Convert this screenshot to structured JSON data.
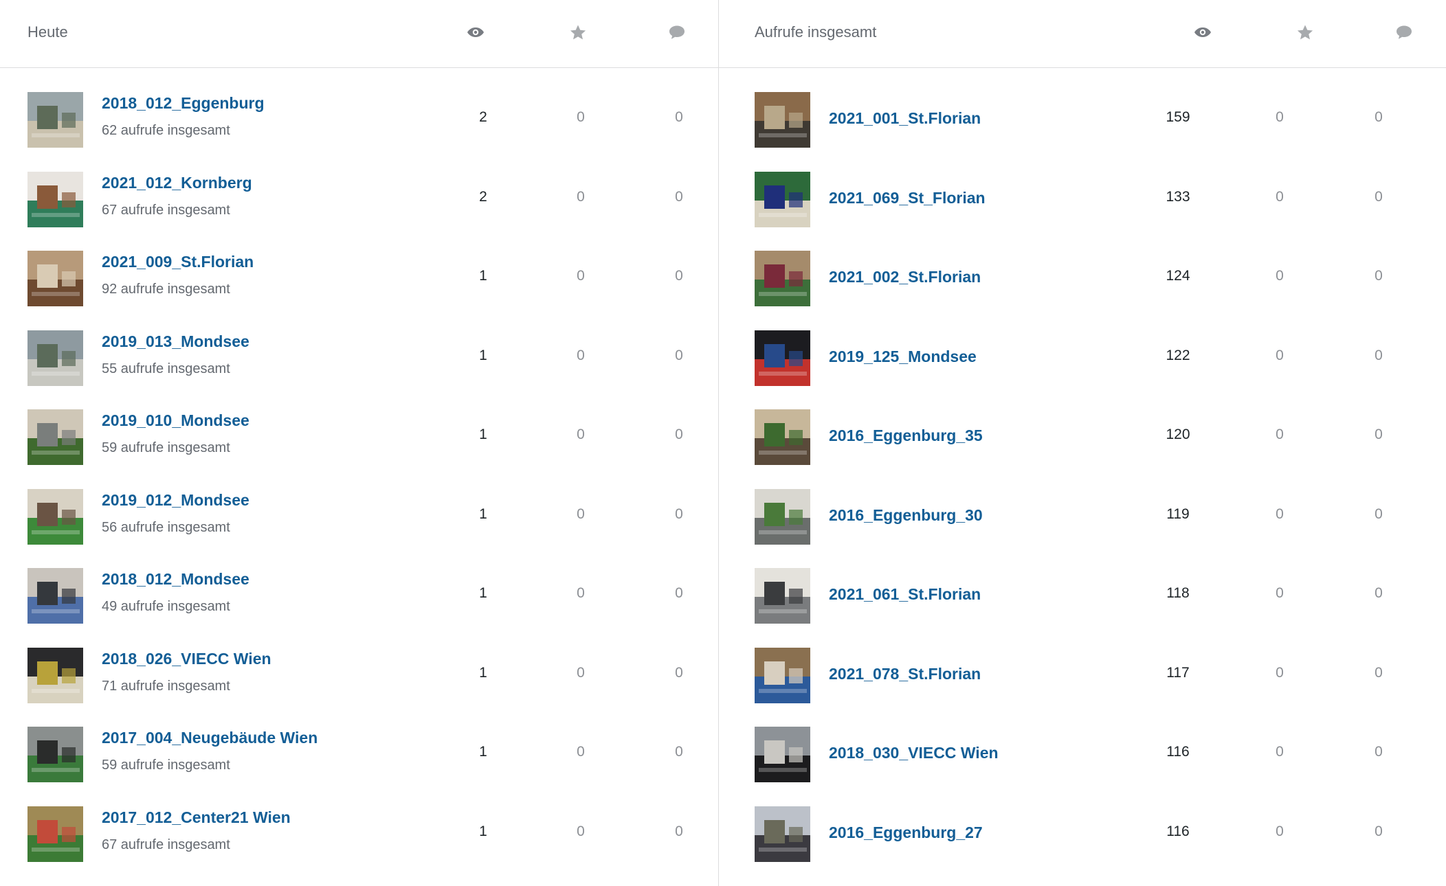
{
  "colors": {
    "link": "#135e96",
    "muted": "#646970",
    "icon": "#a7aaad",
    "divider": "#dcdcde"
  },
  "left": {
    "header": {
      "title": "Heute",
      "icons": [
        "eye-icon",
        "star-icon",
        "comment-icon"
      ]
    },
    "rows": [
      {
        "title": "2018_012_Eggenburg",
        "subtitle": "62 aufrufe insgesamt",
        "views": "2",
        "likes": "0",
        "comments": "0",
        "thumb": [
          "#9aa6a9",
          "#c9c1ad",
          "#5d6b58"
        ]
      },
      {
        "title": "2021_012_Kornberg",
        "subtitle": "67 aufrufe insgesamt",
        "views": "2",
        "likes": "0",
        "comments": "0",
        "thumb": [
          "#e8e4df",
          "#2f7d5a",
          "#8a5a3a"
        ]
      },
      {
        "title": "2021_009_St.Florian",
        "subtitle": "92 aufrufe insgesamt",
        "views": "1",
        "likes": "0",
        "comments": "0",
        "thumb": [
          "#b79a7a",
          "#6e4a30",
          "#d9cbb4"
        ]
      },
      {
        "title": "2019_013_Mondsee",
        "subtitle": "55 aufrufe insgesamt",
        "views": "1",
        "likes": "0",
        "comments": "0",
        "thumb": [
          "#8e9aa0",
          "#c7c7c0",
          "#5b6b5a"
        ]
      },
      {
        "title": "2019_010_Mondsee",
        "subtitle": "59 aufrufe insgesamt",
        "views": "1",
        "likes": "0",
        "comments": "0",
        "thumb": [
          "#cfc7b7",
          "#3f6a2e",
          "#7a7e7c"
        ]
      },
      {
        "title": "2019_012_Mondsee",
        "subtitle": "56 aufrufe insgesamt",
        "views": "1",
        "likes": "0",
        "comments": "0",
        "thumb": [
          "#d8d2c4",
          "#3d8a3a",
          "#6a5444"
        ]
      },
      {
        "title": "2018_012_Mondsee",
        "subtitle": "49 aufrufe insgesamt",
        "views": "1",
        "likes": "0",
        "comments": "0",
        "thumb": [
          "#c9c4bd",
          "#4f6fa8",
          "#34383d"
        ]
      },
      {
        "title": "2018_026_VIECC Wien",
        "subtitle": "71 aufrufe insgesamt",
        "views": "1",
        "likes": "0",
        "comments": "0",
        "thumb": [
          "#2a2a2c",
          "#d8d2bf",
          "#b8a23a"
        ]
      },
      {
        "title": "2017_004_Neugebäude Wien",
        "subtitle": "59 aufrufe insgesamt",
        "views": "1",
        "likes": "0",
        "comments": "0",
        "thumb": [
          "#8a8f8e",
          "#3a7a3b",
          "#2a2c2b"
        ]
      },
      {
        "title": "2017_012_Center21 Wien",
        "subtitle": "67 aufrufe insgesamt",
        "views": "1",
        "likes": "0",
        "comments": "0",
        "thumb": [
          "#9f8a55",
          "#3c7b35",
          "#c24b3a"
        ]
      }
    ]
  },
  "right": {
    "header": {
      "title": "Aufrufe insgesamt",
      "icons": [
        "eye-icon",
        "star-icon",
        "comment-icon"
      ]
    },
    "rows": [
      {
        "title": "2021_001_St.Florian",
        "views": "159",
        "likes": "0",
        "comments": "0",
        "thumb": [
          "#8a6a4a",
          "#3f3a33",
          "#b8a88a"
        ]
      },
      {
        "title": "2021_069_St_Florian",
        "views": "133",
        "likes": "0",
        "comments": "0",
        "thumb": [
          "#2d6a3a",
          "#d8d2c0",
          "#1f2f7a"
        ]
      },
      {
        "title": "2021_002_St.Florian",
        "views": "124",
        "likes": "0",
        "comments": "0",
        "thumb": [
          "#a58b6b",
          "#3d6f3a",
          "#7a2a3a"
        ]
      },
      {
        "title": "2019_125_Mondsee",
        "views": "122",
        "likes": "0",
        "comments": "0",
        "thumb": [
          "#1c1c20",
          "#c2322c",
          "#274a8a"
        ]
      },
      {
        "title": "2016_Eggenburg_35",
        "views": "120",
        "likes": "0",
        "comments": "0",
        "thumb": [
          "#c7b79a",
          "#5a4a3a",
          "#3d6a2f"
        ]
      },
      {
        "title": "2016_Eggenburg_30",
        "views": "119",
        "likes": "0",
        "comments": "0",
        "thumb": [
          "#d9d7d0",
          "#6a6e6c",
          "#4a7a3a"
        ]
      },
      {
        "title": "2021_061_St.Florian",
        "views": "118",
        "likes": "0",
        "comments": "0",
        "thumb": [
          "#e4e2dc",
          "#7a7c7e",
          "#3a3c3e"
        ]
      },
      {
        "title": "2021_078_St.Florian",
        "views": "117",
        "likes": "0",
        "comments": "0",
        "thumb": [
          "#8a7050",
          "#2c5a9a",
          "#d8cfc0"
        ]
      },
      {
        "title": "2018_030_VIECC Wien",
        "views": "116",
        "likes": "0",
        "comments": "0",
        "thumb": [
          "#8d9297",
          "#1c1c1e",
          "#c9c7c2"
        ]
      },
      {
        "title": "2016_Eggenburg_27",
        "views": "116",
        "likes": "0",
        "comments": "0",
        "thumb": [
          "#bcc1c9",
          "#3b3a40",
          "#6a6a5a"
        ]
      }
    ]
  }
}
